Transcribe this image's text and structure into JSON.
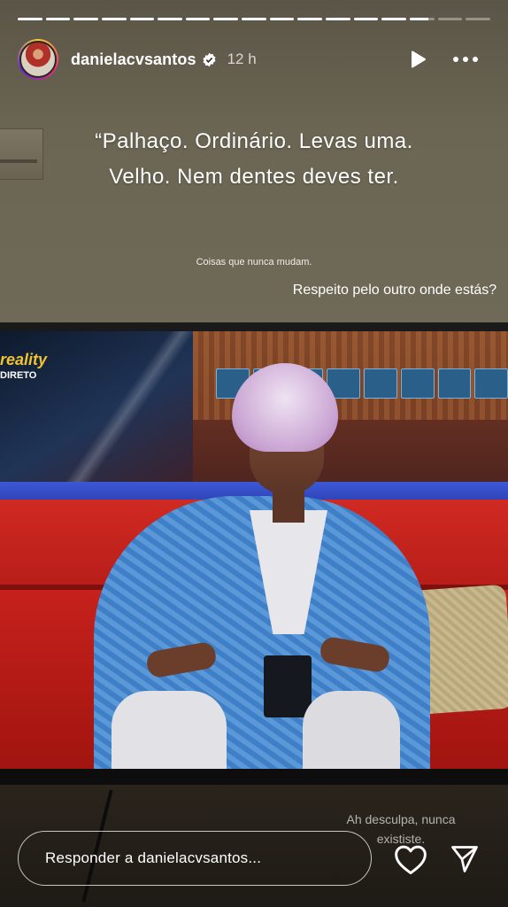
{
  "header": {
    "username": "danielacvsantos",
    "time": "12 h",
    "verified": true,
    "avatar_icon": "profile-photo"
  },
  "progress": {
    "segments_total": 17,
    "segments_viewed": 14,
    "current_segment_progress": 0.75
  },
  "story": {
    "quote": "“Palhaço. Ordinário. Levas uma. Velho. Nem dentes deves ter.",
    "small_note": "Coisas que nunca mudam.",
    "side_question": "Respeito pelo outro onde estás?",
    "tv_logo": "reality",
    "tv_live_tag": "DIRETO",
    "bottom_note": "Ah desculpa, nunca exististe."
  },
  "reply": {
    "placeholder": "Responder a danielacvsantos..."
  },
  "icons": {
    "play": "play-icon",
    "more": "more-icon",
    "heart": "heart-icon",
    "send": "send-icon",
    "verified": "verified-badge-icon"
  }
}
